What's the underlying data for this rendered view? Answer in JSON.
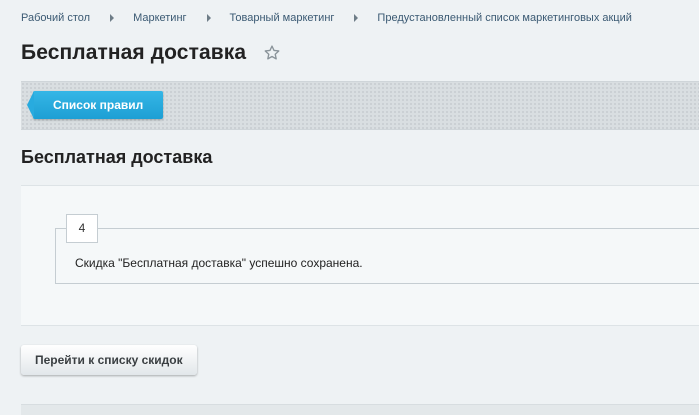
{
  "breadcrumb": [
    {
      "label": "Рабочий стол"
    },
    {
      "label": "Маркетинг"
    },
    {
      "label": "Товарный маркетинг"
    },
    {
      "label": "Предустановленный список маркетинговых акций"
    }
  ],
  "header": {
    "title": "Бесплатная доставка",
    "favorite_icon": "star-outline-icon"
  },
  "toolbar": {
    "list_button_label": "Список правил"
  },
  "section": {
    "title": "Бесплатная доставка"
  },
  "message": {
    "badge": "4",
    "text": "Скидка \"Бесплатная доставка\" успешно сохранена."
  },
  "actions": {
    "back_button_label": "Перейти к списку скидок"
  },
  "colors": {
    "accent": "#1d9fd4",
    "link": "#3b5a73"
  }
}
